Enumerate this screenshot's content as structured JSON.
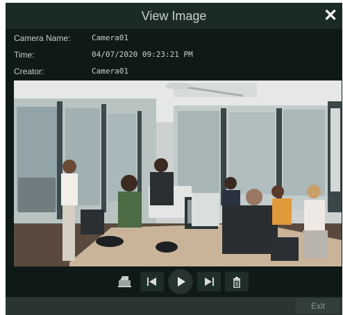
{
  "dialog": {
    "title": "View Image",
    "close_icon": "close-icon"
  },
  "info": {
    "camera_name_label": "Camera Name:",
    "camera_name_value": "Camera01",
    "time_label": "Time:",
    "time_value": "04/07/2020 09:23:21 PM",
    "creator_label": "Creator:",
    "creator_value": "Camera01"
  },
  "toolbar": {
    "icons": [
      "print-icon",
      "previous-icon",
      "play-icon",
      "next-icon",
      "delete-icon"
    ]
  },
  "footer": {
    "exit_label": "Exit"
  },
  "colors": {
    "background": "#0f1a18",
    "titlebar": "#1a2a27",
    "text": "#c9cfcd"
  }
}
